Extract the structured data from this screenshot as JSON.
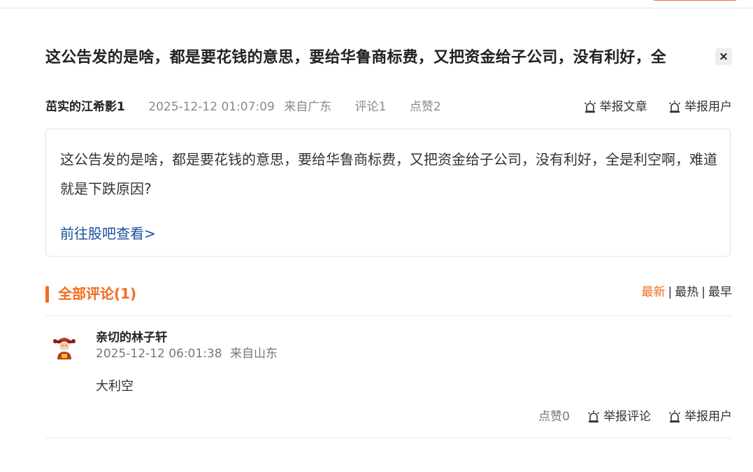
{
  "article": {
    "title": "这公告发的是啥，都是要花钱的意思，要给华鲁商标费，又把资金给子公司，没有利好，全",
    "close_icon": "×",
    "author": "茁实的江希影1",
    "time": "2025-12-12 01:07:09",
    "location": "来自广东",
    "comments": "评论1",
    "likes": "点赞2",
    "report_article": "举报文章",
    "report_user": "举报用户",
    "body": "这公告发的是啥，都是要花钱的意思，要给华鲁商标费，又把资金给子公司，没有利好，全是利空啊，难道就是下跌原因?",
    "goto_link": "前往股吧查看>"
  },
  "comments_section": {
    "title": "全部评论(1)",
    "sort": {
      "newest": "最新",
      "hottest": "最热",
      "earliest": "最早",
      "separator": "|"
    },
    "accent_color": "#f26c1d"
  },
  "comment": {
    "author": "亲切的林子轩",
    "time": "2025-12-12 06:01:38",
    "location": "来自山东",
    "text": "大利空",
    "likes": "点赞0",
    "report_comment": "举报评论",
    "report_user": "举报用户"
  },
  "icons": {
    "report": "alarm-light-icon",
    "close": "close-icon",
    "avatar": "fortune-god-avatar"
  },
  "colors": {
    "link": "#1a4e9c",
    "accent": "#f26c1d"
  }
}
